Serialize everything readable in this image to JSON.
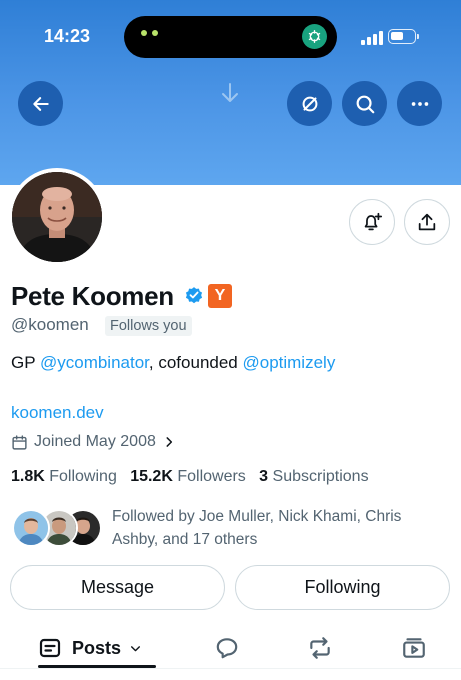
{
  "status_bar": {
    "time": "14:23",
    "battery_level": 0.55
  },
  "header": {
    "back_icon": "arrow-left-icon",
    "mute_icon": "no-sign-icon",
    "search_icon": "search-icon",
    "more_icon": "more-horizontal-icon"
  },
  "actions": {
    "notify_icon": "bell-plus-icon",
    "share_icon": "share-icon"
  },
  "profile": {
    "name": "Pete Koomen",
    "yc_badge": "Y",
    "handle": "@koomen",
    "follows_you": "Follows you",
    "bio_prefix": "GP ",
    "bio_mention_1": "@ycombinator",
    "bio_middle": ", cofounded ",
    "bio_mention_2": "@optimizely",
    "website": "koomen.dev",
    "joined": "Joined May 2008"
  },
  "stats": {
    "following_count": "1.8K",
    "following_label": "Following",
    "followers_count": "15.2K",
    "followers_label": "Followers",
    "subscriptions_count": "3",
    "subscriptions_label": "Subscriptions"
  },
  "followed_by": {
    "text": "Followed by Joe Muller, Nick Khami, Chris Ashby, and 17 others"
  },
  "buttons": {
    "message": "Message",
    "following": "Following"
  },
  "tabs": {
    "posts_label": "Posts"
  },
  "colors": {
    "banner": "#3d8be0",
    "link": "#1d9bf0",
    "verified": "#1d9bf0",
    "yc_badge": "#f26522"
  }
}
